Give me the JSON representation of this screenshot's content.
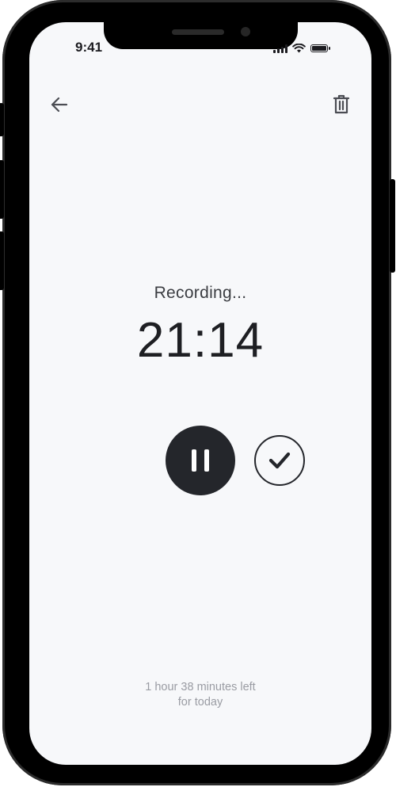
{
  "status_bar": {
    "time": "9:41",
    "icons": [
      "signal-icon",
      "wifi-icon",
      "battery-icon"
    ]
  },
  "toolbar": {
    "back_icon": "arrow-left-icon",
    "delete_icon": "trash-icon"
  },
  "recording": {
    "status_label": "Recording...",
    "elapsed_time": "21:14",
    "pause_icon": "pause-icon",
    "done_icon": "check-icon"
  },
  "quota": {
    "line1": "1 hour 38 minutes left",
    "line2": "for today"
  },
  "colors": {
    "background": "#f7f8fa",
    "primary": "#24262b",
    "muted_text": "#9a9ca3"
  }
}
